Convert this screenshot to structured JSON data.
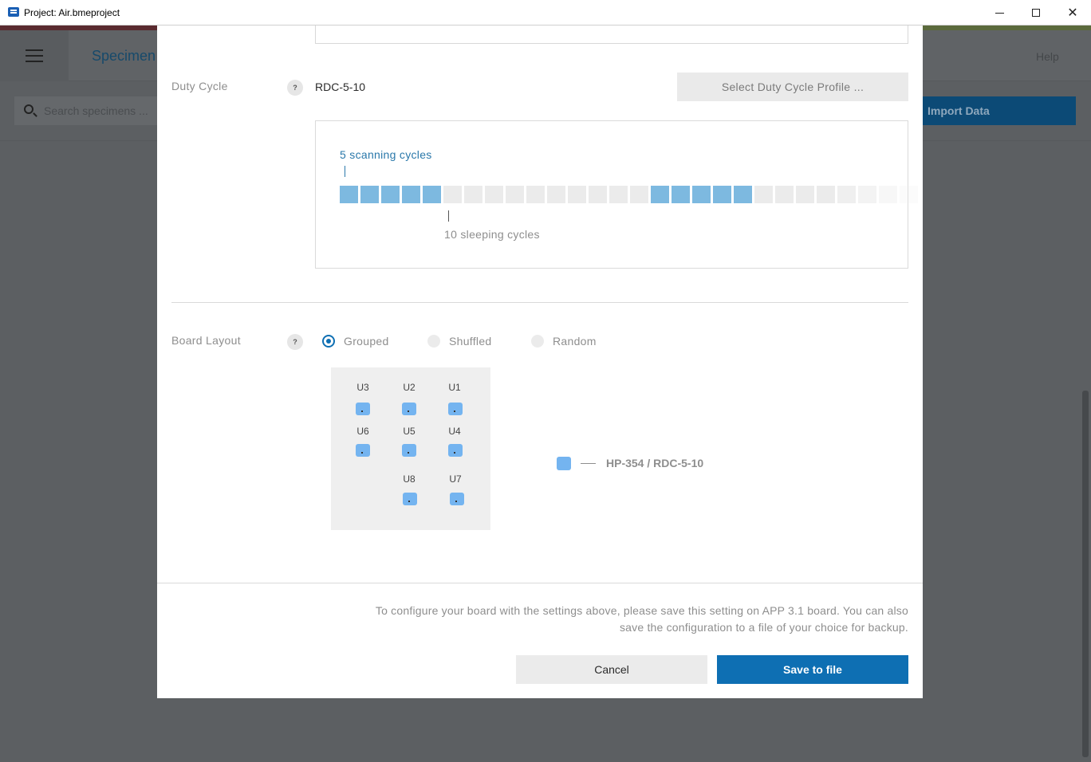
{
  "window": {
    "title": "Project: Air.bmeproject"
  },
  "app": {
    "title": "Specimen",
    "help": "Help",
    "search_placeholder": "Search specimens ...",
    "import_label": "Import Data"
  },
  "duty_cycle": {
    "label": "Duty Cycle",
    "help": "?",
    "value": "RDC-5-10",
    "select_button": "Select Duty Cycle Profile ...",
    "scanning_label": "5 scanning cycles",
    "sleeping_label": "10 sleeping cycles",
    "pattern": [
      1,
      1,
      1,
      1,
      1,
      0,
      0,
      0,
      0,
      0,
      0,
      0,
      0,
      0,
      0,
      1,
      1,
      1,
      1,
      1,
      0,
      0,
      0,
      0,
      0,
      0,
      0,
      0
    ]
  },
  "board_layout": {
    "label": "Board Layout",
    "help": "?",
    "options": [
      "Grouped",
      "Shuffled",
      "Random"
    ],
    "selected": "Grouped",
    "units": [
      "U3",
      "U2",
      "U1",
      "U6",
      "U5",
      "U4",
      "U8",
      "U7"
    ],
    "legend": "HP-354 / RDC-5-10",
    "chip_color": "#74b4f0"
  },
  "footer": {
    "note": "To configure your board with the settings above, please save this setting on APP 3.1 board. You can also save the configuration to a file of your choice for backup.",
    "cancel": "Cancel",
    "save": "Save to file"
  },
  "colors": {
    "accent": "#0e6fb3",
    "scan_cell": "#7db9e0",
    "sleep_cell": "#ebebeb"
  }
}
